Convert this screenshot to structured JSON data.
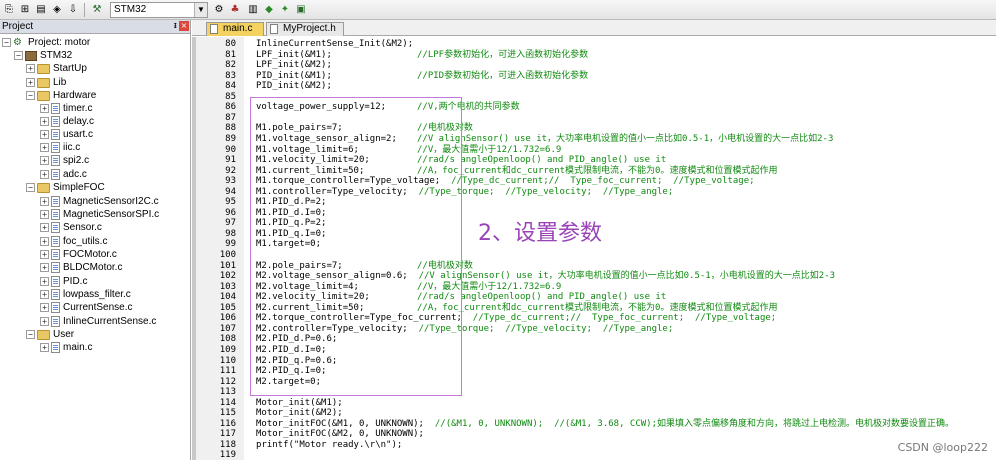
{
  "toolbar": {
    "target_name": "STM32",
    "icons": [
      "build-icon",
      "rebuild-icon",
      "batch-build-icon",
      "stop-build-icon",
      "download-icon",
      "target-options-icon",
      "manage-project-icon",
      "file-extensions-icon",
      "select-packs-icon",
      "pack-installer-icon",
      "manage-components-icon"
    ]
  },
  "project_panel": {
    "title": "Project",
    "project_label": "Project: motor",
    "target_label": "STM32",
    "groups": [
      {
        "name": "StartUp",
        "expanded": false,
        "files": []
      },
      {
        "name": "Lib",
        "expanded": false,
        "files": []
      },
      {
        "name": "Hardware",
        "expanded": true,
        "files": [
          "timer.c",
          "delay.c",
          "usart.c",
          "iic.c",
          "spi2.c",
          "adc.c"
        ]
      },
      {
        "name": "SimpleFOC",
        "expanded": true,
        "files": [
          "MagneticSensorI2C.c",
          "MagneticSensorSPI.c",
          "Sensor.c",
          "foc_utils.c",
          "FOCMotor.c",
          "BLDCMotor.c",
          "PID.c",
          "lowpass_filter.c",
          "CurrentSense.c",
          "InlineCurrentSense.c"
        ]
      },
      {
        "name": "User",
        "expanded": true,
        "files": [
          "main.c"
        ]
      }
    ]
  },
  "tabs": [
    {
      "label": "main.c",
      "active": true
    },
    {
      "label": "MyProject.h",
      "active": false
    }
  ],
  "code_lines": [
    {
      "n": "80",
      "code": "InlineCurrentSense_Init(&M2);",
      "comment": ""
    },
    {
      "n": "81",
      "code": "LPF_init(&M1);",
      "comment": "//LPF参数初始化，可进入函数初始化参数"
    },
    {
      "n": "82",
      "code": "LPF_init(&M2);",
      "comment": ""
    },
    {
      "n": "83",
      "code": "PID_init(&M1);",
      "comment": "//PID参数初始化，可进入函数初始化参数"
    },
    {
      "n": "84",
      "code": "PID_init(&M2);",
      "comment": ""
    },
    {
      "n": "85",
      "code": "",
      "comment": ""
    },
    {
      "n": "86",
      "code": "voltage_power_supply=12;",
      "comment": "//V,两个电机的共同参数"
    },
    {
      "n": "87",
      "code": "",
      "comment": ""
    },
    {
      "n": "88",
      "code": "M1.pole_pairs=7;",
      "comment": "//电机极对数"
    },
    {
      "n": "89",
      "code": "M1.voltage_sensor_align=2;",
      "comment": "//V alignSensor() use it，大功率电机设置的值小一点比如0.5-1，小电机设置的大一点比如2-3"
    },
    {
      "n": "90",
      "code": "M1.voltage_limit=6;",
      "comment": "//V，最大值需小于12/1.732=6.9"
    },
    {
      "n": "91",
      "code": "M1.velocity_limit=20;",
      "comment": "//rad/s angleOpenloop() and PID_angle() use it"
    },
    {
      "n": "92",
      "code": "M1.current_limit=50;",
      "comment": "//A，foc_current和dc_current模式限制电流，不能为0。速度模式和位置模式起作用"
    },
    {
      "n": "93",
      "code": "M1.torque_controller=Type_voltage;",
      "comment": "//Type_dc_current;//  Type_foc_current;  //Type_voltage;"
    },
    {
      "n": "94",
      "code": "M1.controller=Type_velocity;",
      "comment": "//Type_torque;  //Type_velocity;  //Type_angle;"
    },
    {
      "n": "95",
      "code": "M1.PID_d.P=2;",
      "comment": ""
    },
    {
      "n": "96",
      "code": "M1.PID_d.I=0;",
      "comment": ""
    },
    {
      "n": "97",
      "code": "M1.PID_q.P=2;",
      "comment": ""
    },
    {
      "n": "98",
      "code": "M1.PID_q.I=0;",
      "comment": ""
    },
    {
      "n": "99",
      "code": "M1.target=0;",
      "comment": ""
    },
    {
      "n": "100",
      "code": "",
      "comment": ""
    },
    {
      "n": "101",
      "code": "M2.pole_pairs=7;",
      "comment": "//电机极对数"
    },
    {
      "n": "102",
      "code": "M2.voltage_sensor_align=0.6;",
      "comment": "//V alignSensor() use it，大功率电机设置的值小一点比如0.5-1，小电机设置的大一点比如2-3"
    },
    {
      "n": "103",
      "code": "M2.voltage_limit=4;",
      "comment": "//V，最大值需小于12/1.732=6.9"
    },
    {
      "n": "104",
      "code": "M2.velocity_limit=20;",
      "comment": "//rad/s angleOpenloop() and PID_angle() use it"
    },
    {
      "n": "105",
      "code": "M2.current_limit=50;",
      "comment": "//A，foc_current和dc_current模式限制电流，不能为0。速度模式和位置模式起作用"
    },
    {
      "n": "106",
      "code": "M2.torque_controller=Type_foc_current;",
      "comment": "//Type_dc_current;//  Type_foc_current;  //Type_voltage;"
    },
    {
      "n": "107",
      "code": "M2.controller=Type_velocity;",
      "comment": "//Type_torque;  //Type_velocity;  //Type_angle;"
    },
    {
      "n": "108",
      "code": "M2.PID_d.P=0.6;",
      "comment": ""
    },
    {
      "n": "109",
      "code": "M2.PID_d.I=0;",
      "comment": ""
    },
    {
      "n": "110",
      "code": "M2.PID_q.P=0.6;",
      "comment": ""
    },
    {
      "n": "111",
      "code": "M2.PID_q.I=0;",
      "comment": ""
    },
    {
      "n": "112",
      "code": "M2.target=0;",
      "comment": ""
    },
    {
      "n": "113",
      "code": "",
      "comment": ""
    },
    {
      "n": "114",
      "code": "Motor_init(&M1);",
      "comment": ""
    },
    {
      "n": "115",
      "code": "Motor_init(&M2);",
      "comment": ""
    },
    {
      "n": "116",
      "code": "Motor_initFOC(&M1, 0, UNKNOWN);",
      "comment": "//(&M1, 0, UNKNOWN);  //(&M1, 3.68, CCW);如果填入零点偏移角度和方向，将跳过上电检测。电机极对数要设置正确。"
    },
    {
      "n": "117",
      "code": "Motor_initFOC(&M2, 0, UNKNOWN);",
      "comment": ""
    },
    {
      "n": "118",
      "code": "printf(\"Motor ready.\\r\\n\");",
      "comment": ""
    },
    {
      "n": "119",
      "code": "",
      "comment": ""
    }
  ],
  "annotation": "2、设置参数",
  "watermark": "CSDN @loop222",
  "colors": {
    "comment": "#108a10",
    "annotation": "#9a43b8",
    "active_tab": "#f4d25f"
  }
}
